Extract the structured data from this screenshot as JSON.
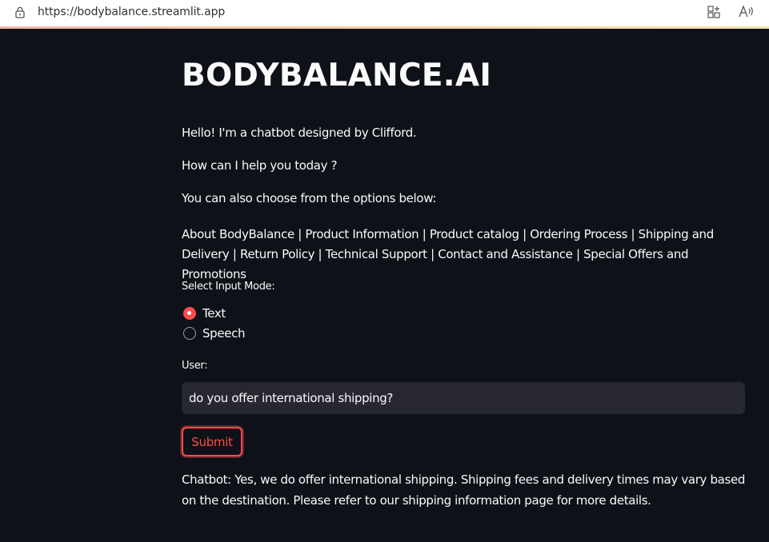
{
  "browser": {
    "url": "https://bodybalance.streamlit.app"
  },
  "app": {
    "title": "BODYBALANCE.AI",
    "greeting": "Hello! I'm a chatbot designed by Clifford.",
    "help_prompt": "How can I help you today ?",
    "options_intro": "You can also choose from the options below:",
    "options": "About BodyBalance | Product Information | Product catalog | Ordering Process | Shipping and Delivery | Return Policy | Technical Support | Contact and Assistance | Special Offers and Promotions",
    "input_mode_label": "Select Input Mode:",
    "input_modes": [
      {
        "label": "Text",
        "selected": true
      },
      {
        "label": "Speech",
        "selected": false
      }
    ],
    "user_label": "User:",
    "user_input_value": "do you offer international shipping?",
    "submit_label": "Submit",
    "response": "Chatbot: Yes, we do offer international shipping. Shipping fees and delivery times may vary based on the destination. Please refer to our shipping information page for more details."
  },
  "colors": {
    "background": "#0e1117",
    "accent": "#ff4b4b",
    "input_background": "#262730"
  }
}
